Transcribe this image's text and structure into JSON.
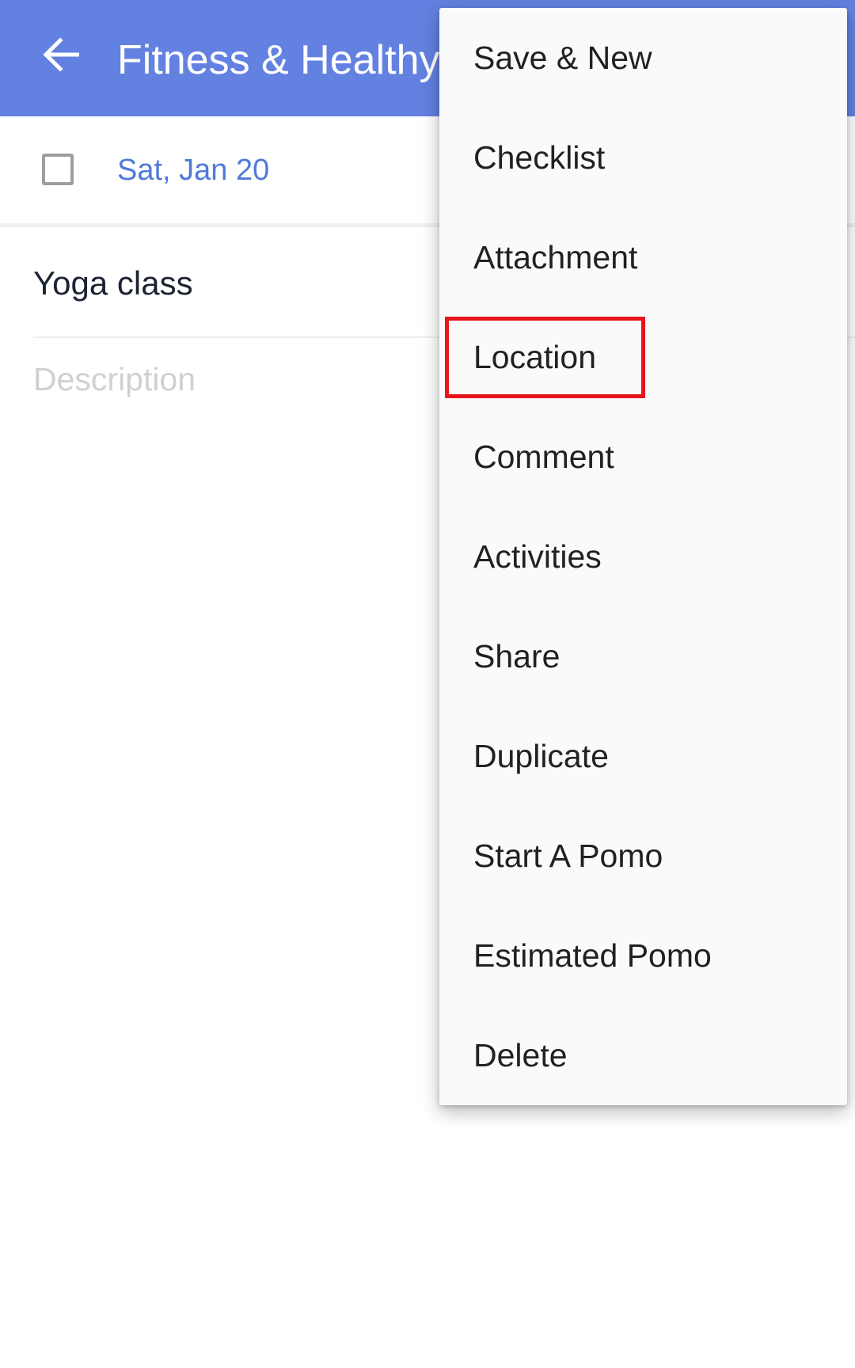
{
  "app_bar": {
    "title": "Fitness & Healthy",
    "back_icon": "arrow-left-icon",
    "color": "#6381e0"
  },
  "task": {
    "due_date": "Sat, Jan 20",
    "title": "Yoga class",
    "description_placeholder": "Description",
    "checked": false
  },
  "menu": {
    "items": [
      {
        "label": "Save & New"
      },
      {
        "label": "Checklist"
      },
      {
        "label": "Attachment"
      },
      {
        "label": "Location"
      },
      {
        "label": "Comment"
      },
      {
        "label": "Activities"
      },
      {
        "label": "Share"
      },
      {
        "label": "Duplicate"
      },
      {
        "label": "Start A Pomo"
      },
      {
        "label": "Estimated Pomo"
      },
      {
        "label": "Delete"
      }
    ],
    "highlighted_item": "Location",
    "highlight_color": "#e8141b"
  }
}
